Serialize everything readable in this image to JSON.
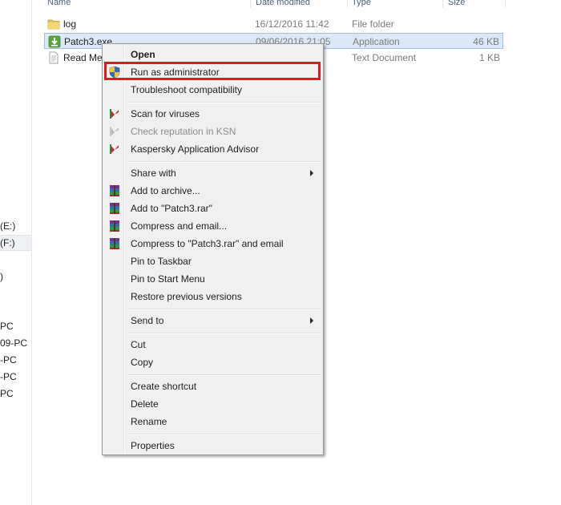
{
  "columns": {
    "name": "Name",
    "date_modified": "Date modified",
    "type": "Type",
    "size": "Size"
  },
  "files": [
    {
      "name": "log",
      "date": "16/12/2016 11:42",
      "type": "File folder",
      "size": "",
      "icon": "folder-icon"
    },
    {
      "name": "Patch3.exe",
      "date": "09/06/2016 21:05",
      "type": "Application",
      "size": "46 KB",
      "icon": "installer-icon",
      "selected": true
    },
    {
      "name": "Read Me",
      "date": "",
      "type": "Text Document",
      "size": "1 KB",
      "icon": "text-document-icon"
    }
  ],
  "nav_items": [
    "(E:)",
    "(F:)",
    ")",
    "PC",
    "09-PC",
    "-PC",
    "-PC",
    "PC"
  ],
  "context_menu": {
    "items": [
      {
        "label": "Open",
        "bold": true
      },
      {
        "label": "Run as administrator",
        "icon": "uac-shield-icon",
        "highlighted": true
      },
      {
        "label": "Troubleshoot compatibility"
      },
      {
        "sep": true
      },
      {
        "label": "Scan for viruses",
        "icon": "kaspersky-icon"
      },
      {
        "label": "Check reputation in KSN",
        "icon": "kaspersky-icon",
        "disabled": true
      },
      {
        "label": "Kaspersky Application Advisor",
        "icon": "kaspersky-icon"
      },
      {
        "sep": true
      },
      {
        "label": "Share with",
        "submenu": true
      },
      {
        "label": "Add to archive...",
        "icon": "winrar-icon"
      },
      {
        "label": "Add to \"Patch3.rar\"",
        "icon": "winrar-icon"
      },
      {
        "label": "Compress and email...",
        "icon": "winrar-icon"
      },
      {
        "label": "Compress to \"Patch3.rar\" and email",
        "icon": "winrar-icon"
      },
      {
        "label": "Pin to Taskbar"
      },
      {
        "label": "Pin to Start Menu"
      },
      {
        "label": "Restore previous versions"
      },
      {
        "sep": true
      },
      {
        "label": "Send to",
        "submenu": true
      },
      {
        "sep": true
      },
      {
        "label": "Cut"
      },
      {
        "label": "Copy"
      },
      {
        "sep": true
      },
      {
        "label": "Create shortcut"
      },
      {
        "label": "Delete"
      },
      {
        "label": "Rename"
      },
      {
        "sep": true
      },
      {
        "label": "Properties"
      }
    ]
  },
  "colors": {
    "highlight_box": "#e3151f",
    "selection": "#dbe8f7",
    "menu_bg": "#f0f0f0"
  }
}
